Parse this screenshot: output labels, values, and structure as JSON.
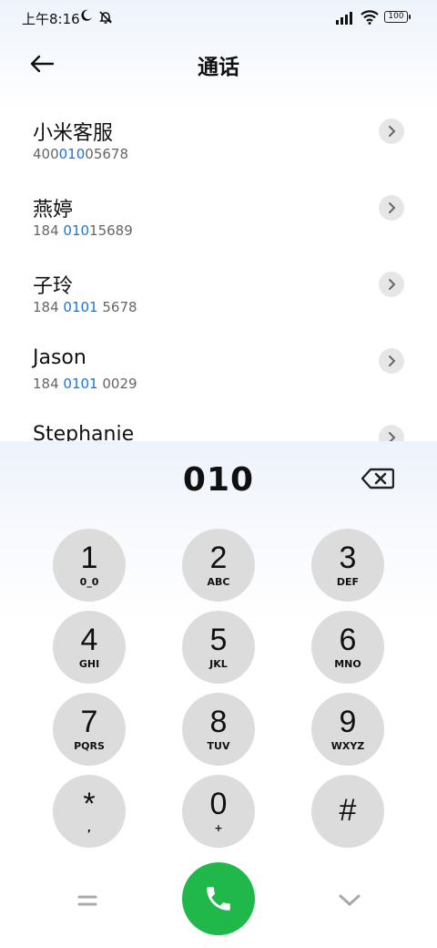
{
  "status_bar": {
    "time": "上午8:16",
    "battery": "100",
    "icons": [
      "moon-icon",
      "bell-off-icon",
      "signal-icon",
      "wifi-icon",
      "battery-icon"
    ]
  },
  "header": {
    "title": "通话",
    "back_icon": "arrow-left-icon"
  },
  "contacts": [
    {
      "name": "小米客服",
      "number_pre": "400",
      "number_match": "010",
      "number_post": "05678"
    },
    {
      "name": "燕婷",
      "number_pre": "184 ",
      "number_match": "010",
      "number_post": "15689"
    },
    {
      "name": "子玲",
      "number_pre": "184 ",
      "number_match": "0101",
      "number_post": " 5678"
    },
    {
      "name": "Jason",
      "number_pre": "184 ",
      "number_match": "0101",
      "number_post": " 0029"
    },
    {
      "name": "Stephanie",
      "number_pre": "",
      "number_match": "",
      "number_post": ""
    }
  ],
  "dialer": {
    "input": "010",
    "keys": [
      {
        "digit": "1",
        "letters": "0_0"
      },
      {
        "digit": "2",
        "letters": "ABC"
      },
      {
        "digit": "3",
        "letters": "DEF"
      },
      {
        "digit": "4",
        "letters": "GHI"
      },
      {
        "digit": "5",
        "letters": "JKL"
      },
      {
        "digit": "6",
        "letters": "MNO"
      },
      {
        "digit": "7",
        "letters": "PQRS"
      },
      {
        "digit": "8",
        "letters": "TUV"
      },
      {
        "digit": "9",
        "letters": "WXYZ"
      },
      {
        "digit": "*",
        "letters": ","
      },
      {
        "digit": "0",
        "letters": "+"
      },
      {
        "digit": "#",
        "letters": ""
      }
    ]
  },
  "colors": {
    "accent": "#1a73d9",
    "call_green": "#20b84a",
    "key_bg": "#dcdcdc"
  }
}
